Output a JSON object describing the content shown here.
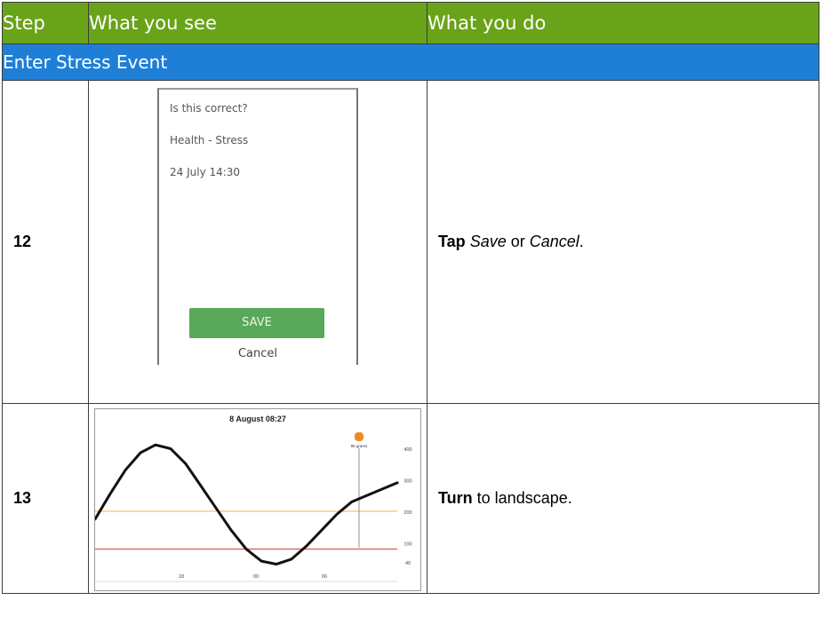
{
  "table": {
    "headers": {
      "step": "Step",
      "see": "What you see",
      "do": "What you do"
    },
    "section_title": "Enter Stress Event"
  },
  "rows": [
    {
      "step": "12",
      "screen": {
        "prompt": "Is this correct?",
        "category": "Health - Stress",
        "datetime": "24 July 14:30",
        "save_label": "SAVE",
        "cancel_label": "Cancel"
      },
      "action": {
        "verb": "Tap",
        "opt1": "Save",
        "mid": " or ",
        "opt2": "Cancel",
        "end": "."
      }
    },
    {
      "step": "13",
      "screen": {
        "chart_title": "8 August 08:27",
        "marker_label": "85 grams"
      },
      "action": {
        "verb": "Turn",
        "rest": " to landscape."
      }
    }
  ],
  "chart_data": {
    "type": "line",
    "title": "8 August 08:27",
    "x_ticks": [
      "18",
      "00",
      "06"
    ],
    "y_ticks": [
      "400",
      "300",
      "200",
      "100",
      "40"
    ],
    "ylim": [
      0,
      450
    ],
    "reference_lines": [
      {
        "value": 200,
        "color": "#f5c97a"
      },
      {
        "value": 80,
        "color": "#e06060"
      }
    ],
    "marker": {
      "label": "85 grams",
      "color": "#f08a24"
    },
    "series": [
      {
        "x": [
          0,
          1,
          2,
          3,
          4,
          5,
          6,
          7,
          8,
          9,
          10,
          11,
          12,
          13,
          14,
          15,
          16,
          17,
          18,
          19,
          20
        ],
        "values": [
          175,
          255,
          330,
          385,
          410,
          398,
          350,
          280,
          210,
          140,
          80,
          42,
          32,
          48,
          90,
          140,
          190,
          230,
          250,
          270,
          290
        ]
      }
    ],
    "colors": {
      "line": "#111111"
    }
  }
}
